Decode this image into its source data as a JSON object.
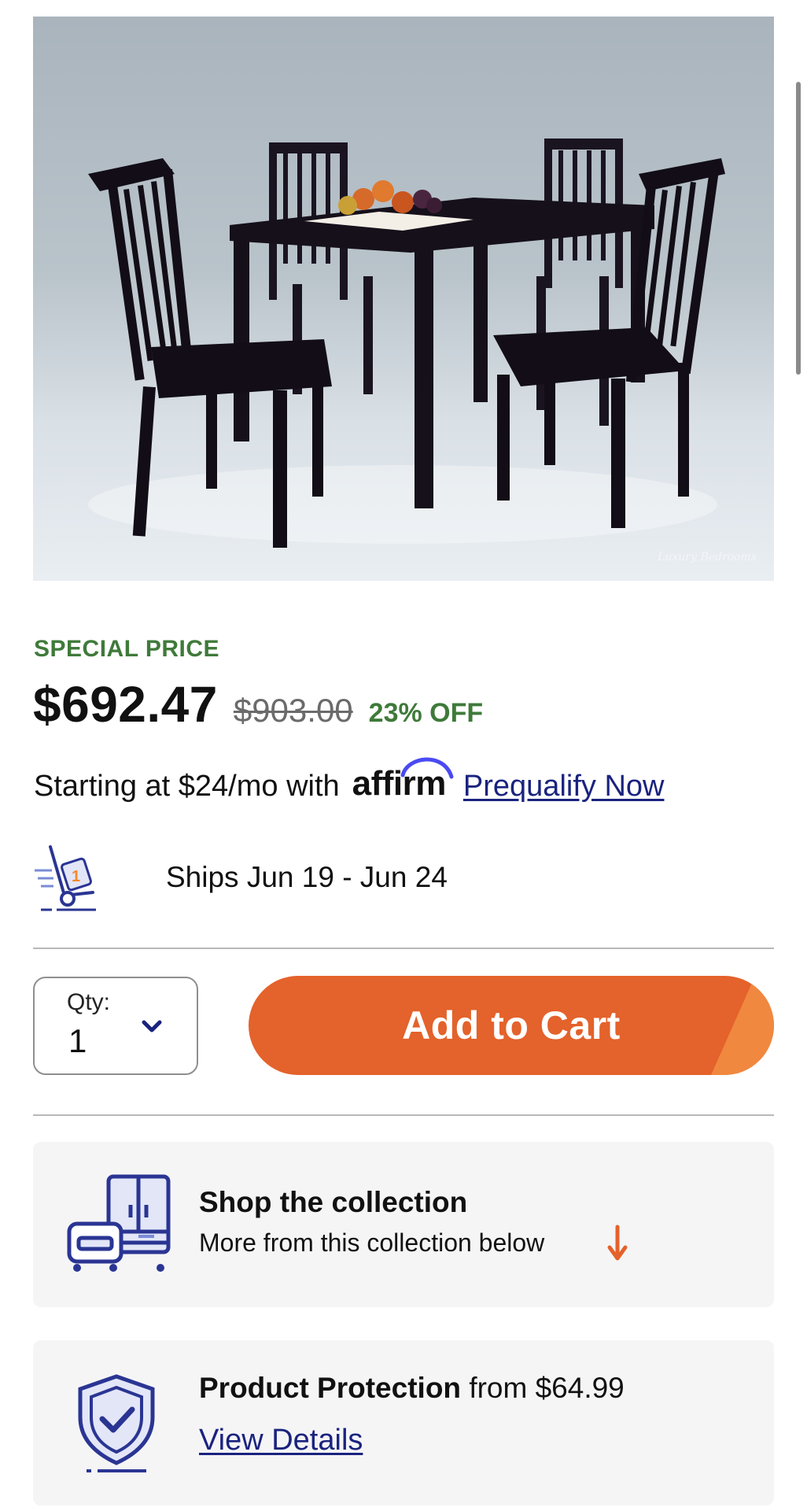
{
  "product": {
    "image_alt": "Dining table with four chairs",
    "image_watermark": "Luxury Bedrooms"
  },
  "pricing": {
    "special_label": "SPECIAL PRICE",
    "current_price": "$692.47",
    "original_price": "$903.00",
    "discount": "23% OFF",
    "accent_color": "#3f7a3a"
  },
  "financing": {
    "text": "Starting at $24/mo with",
    "provider_logo": "affirm",
    "link_label": "Prequalify Now"
  },
  "shipping": {
    "icon": "hand-truck-icon",
    "text": "Ships Jun 19 - Jun 24"
  },
  "purchase": {
    "qty_label": "Qty:",
    "qty_value": "1",
    "add_to_cart_label": "Add to Cart",
    "button_color": "#e4622b"
  },
  "collection": {
    "icon": "furniture-icon",
    "title": "Shop the collection",
    "subtitle": "More from this collection below"
  },
  "protection": {
    "icon": "shield-check-icon",
    "title": "Product Protection",
    "price_text": "from $64.99",
    "link_label": "View Details"
  }
}
